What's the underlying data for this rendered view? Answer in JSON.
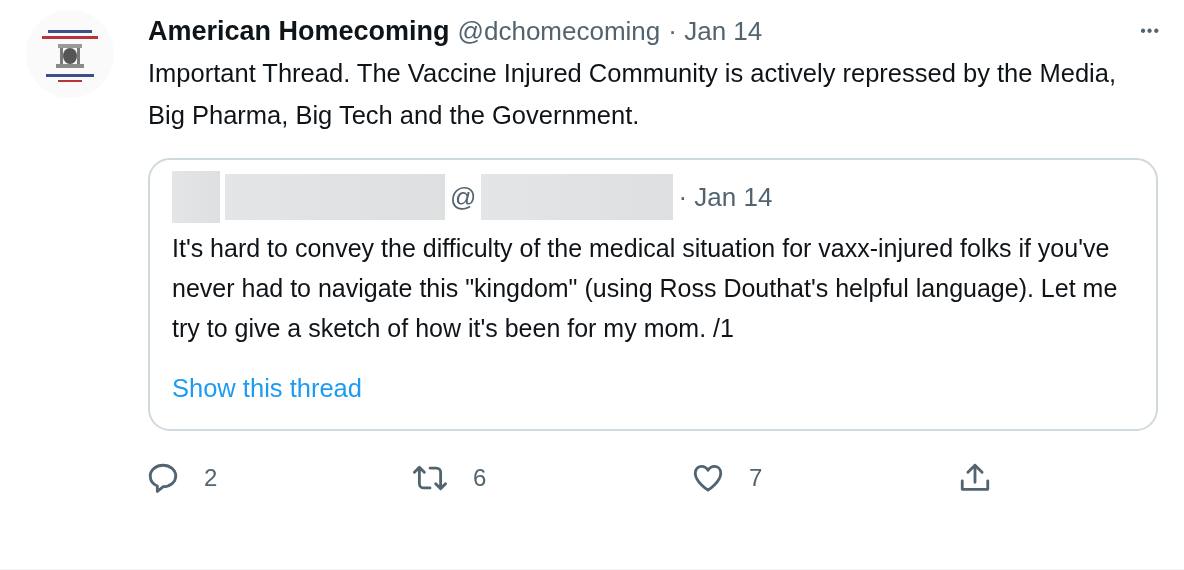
{
  "tweet": {
    "author": {
      "name": "American Homecoming",
      "handle": "@dchomecoming",
      "time": "· Jan 14"
    },
    "text": "Important Thread.  The Vaccine Injured Community is actively repressed by the Media, Big Pharma, Big Tech and the Government.",
    "more_menu": "•••",
    "quote": {
      "author": {
        "at_sign": "@",
        "time": "· Jan 14"
      },
      "text": "It's hard to convey the difficulty of the medical situation for vaxx-injured folks if you've never had to navigate this \"kingdom\" (using Ross Douthat's helpful language). Let me try to give a sketch of how it's been for my mom. /1",
      "link": "Show this thread"
    },
    "actions": [
      {
        "kind": "reply",
        "count": "2"
      },
      {
        "kind": "retweet",
        "count": "6"
      },
      {
        "kind": "like",
        "count": "7"
      },
      {
        "kind": "share"
      }
    ]
  }
}
